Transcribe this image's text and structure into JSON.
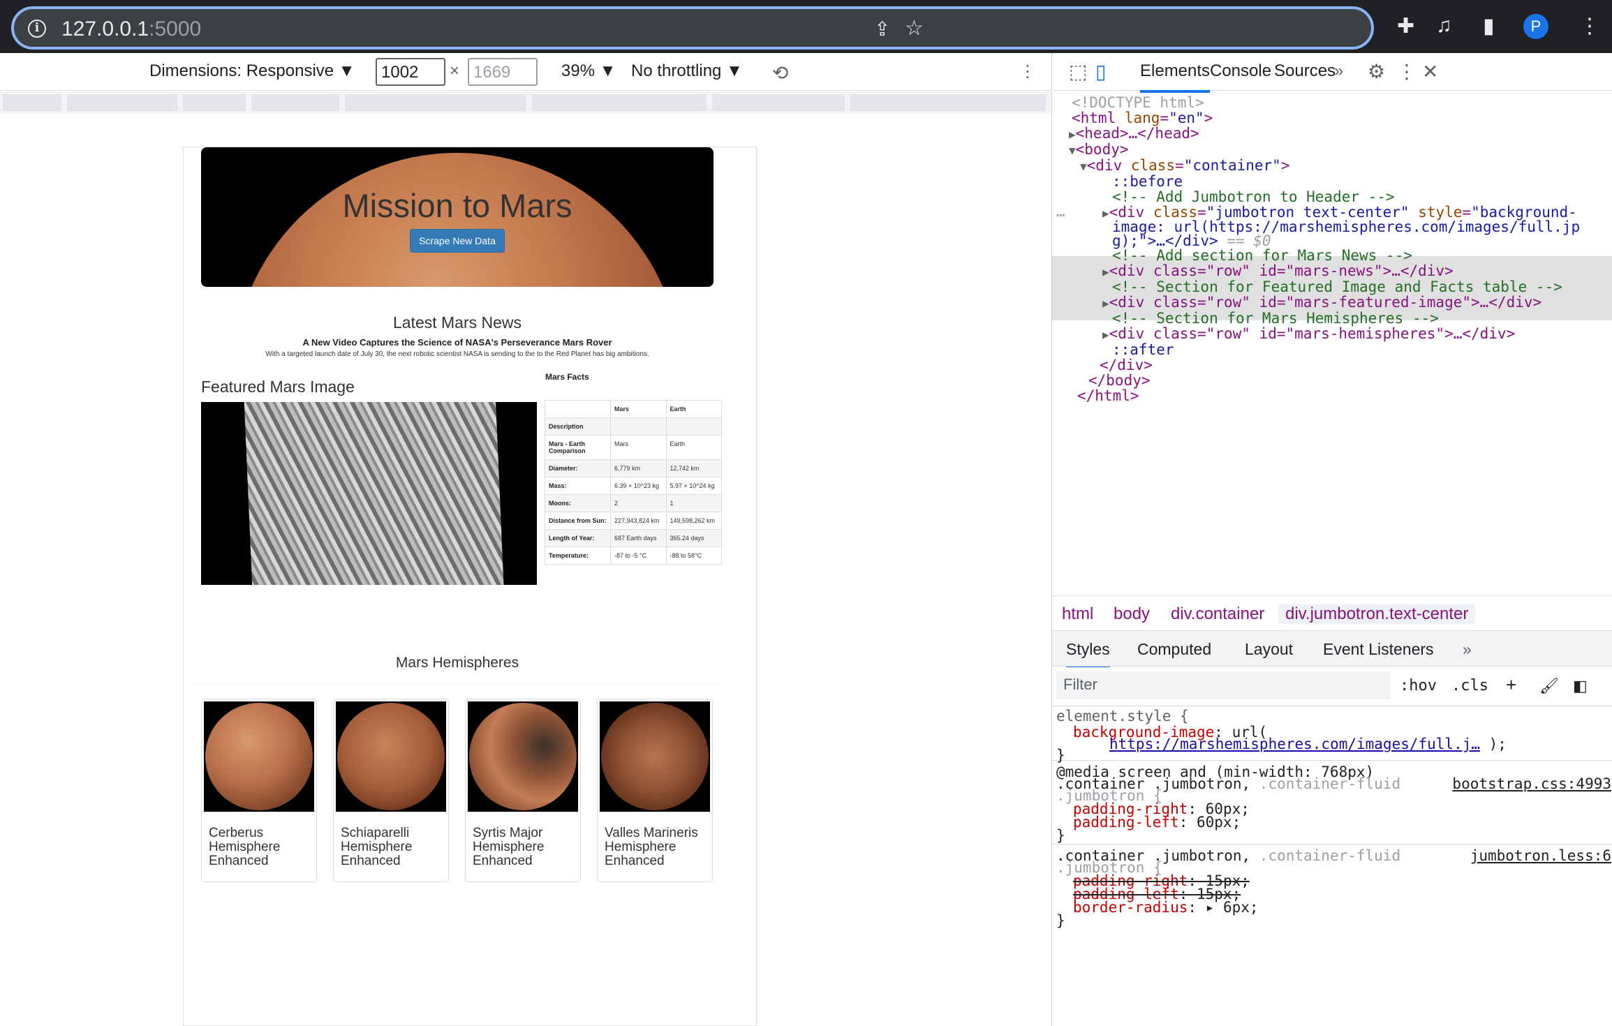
{
  "browser": {
    "url_host": "127.0.0.1",
    "url_port": ":5000",
    "avatar_letter": "P"
  },
  "device_toolbar": {
    "dimensions_label": "Dimensions: Responsive ▼",
    "width": "1002",
    "times": "×",
    "height": "1669",
    "zoom": "39% ▼",
    "throttling": "No throttling ▼"
  },
  "site": {
    "title": "Mission to Mars",
    "scrape_button": "Scrape New Data",
    "news_heading": "Latest Mars News",
    "news_title": "A New Video Captures the Science of NASA's Perseverance Mars Rover",
    "news_paragraph": "With a targeted launch date of July 30, the next robotic scientist NASA is sending to the to the Red Planet has big ambitions.",
    "featured_heading": "Featured Mars Image",
    "facts_heading": "Mars Facts",
    "facts_table": {
      "header": [
        "",
        "Mars",
        "Earth"
      ],
      "rows": [
        [
          "Description",
          "",
          ""
        ],
        [
          "Mars - Earth Comparison",
          "Mars",
          "Earth"
        ],
        [
          "Diameter:",
          "6,779 km",
          "12,742 km"
        ],
        [
          "Mass:",
          "6.39 × 10^23 kg",
          "5.97 × 10^24 kg"
        ],
        [
          "Moons:",
          "2",
          "1"
        ],
        [
          "Distance from Sun:",
          "227,943,824 km",
          "149,598,262 km"
        ],
        [
          "Length of Year:",
          "687 Earth days",
          "365.24 days"
        ],
        [
          "Temperature:",
          "-87 to -5 °C",
          "-88 to 58°C"
        ]
      ]
    },
    "hemispheres_heading": "Mars Hemispheres",
    "hemispheres": [
      {
        "label": "Cerberus Hemisphere Enhanced"
      },
      {
        "label": "Schiaparelli Hemisphere Enhanced"
      },
      {
        "label": "Syrtis Major Hemisphere Enhanced"
      },
      {
        "label": "Valles Marineris Hemisphere Enhanced"
      }
    ]
  },
  "devtools": {
    "tabs": [
      "Elements",
      "Console",
      "Sources",
      "»"
    ],
    "dom_lines": {
      "doctype": "<!DOCTYPE html>",
      "html_open_tag": "<html ",
      "html_lang_attr": "lang",
      "html_lang_val": "\"en\"",
      "head": "<head>…</head>",
      "body_open": "<body>",
      "container_tag": "<div ",
      "container_class_attr": "class",
      "container_class_val": "\"container\"",
      "before": "::before",
      "cmt_jumbo": "<!-- Add Jumbotron to Header -->",
      "jumbo_line1_tag": "<div ",
      "jumbo_line1_class": "class",
      "jumbo_line1_classval": "\"jumbotron text-center\"",
      "jumbo_line1_style": "style",
      "jumbo_line1_styleval": "\"background-",
      "jumbo_line2": "image: url(https://marshemispheres.com/images/full.jp",
      "jumbo_line3": "g);\">…</div>",
      "jumbo_eq": " == $0",
      "cmt_news": "<!-- Add section for Mars News -->",
      "news_div": "<div class=\"row\" id=\"mars-news\">…</div>",
      "cmt_feat": "<!-- Section for Featured Image and Facts table -->",
      "feat_div": "<div class=\"row\" id=\"mars-featured-image\">…</div>",
      "cmt_hemi": "<!-- Section for Mars Hemispheres -->",
      "hemi_div": "<div class=\"row\" id=\"mars-hemispheres\">…</div>",
      "after": "::after",
      "div_close": "</div>",
      "body_close": "</body>",
      "html_close": "</html>"
    },
    "breadcrumbs": [
      "html",
      "body",
      "div.container",
      "div.jumbotron.text-center"
    ],
    "styles_tabs": [
      "Styles",
      "Computed",
      "Layout",
      "Event Listeners",
      "»"
    ],
    "filter_placeholder": "Filter",
    "filter_hov": ":hov",
    "filter_cls": ".cls",
    "rules": {
      "element_style_selector": "element.style {",
      "bg_prop": "background-image",
      "bg_url_open": ": url(",
      "bg_link": "https://marshemispheres.com/images/full.j…",
      "bg_close": " );",
      "close_brace": "}",
      "media_query": "@media screen and (min-width: 768px)",
      "sel1_line1_a": ".container .jumbotron, ",
      "sel1_line1_b": ".container-fluid",
      "sel1_line2": ".jumbotron {",
      "src1": "bootstrap.css:4993",
      "pr_right": "padding-right",
      "pr_right_val": ": 60px;",
      "pr_left": "padding-left",
      "pr_left_val": ": 60px;",
      "src2": "jumbotron.less:6",
      "pr_right2": "padding-right",
      "pr_right2_val": ": 15px;",
      "pr_left2": "padding-left",
      "pr_left2_val": ": 15px;",
      "radius": "border-radius",
      "radius_val": ": ▸ 6px;"
    }
  },
  "colors": {
    "browser_frame": "#202124",
    "url_focus": "#8ab4f8",
    "button_blue": "#337ab7",
    "devtools_accent": "#1a73e8",
    "tag_purple": "#881280",
    "comment_green": "#236e25"
  }
}
